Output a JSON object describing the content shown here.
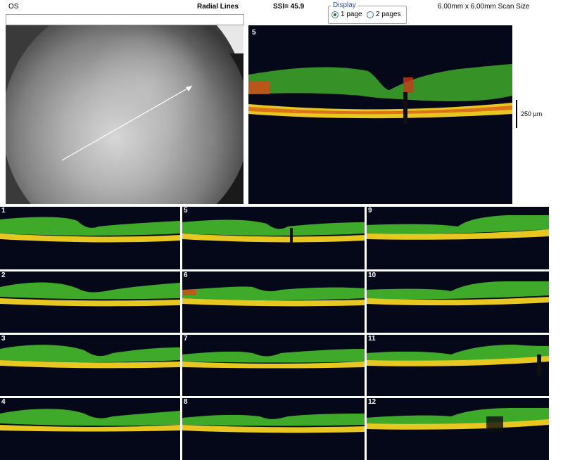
{
  "header": {
    "eye": "OS",
    "scan_name": "Radial Lines",
    "ssi": "SSI= 45.9",
    "scan_size": "6.00mm x 6.00mm Scan Size"
  },
  "display": {
    "legend": "Display",
    "options": [
      "1 page",
      "2 pages"
    ],
    "selected": "1 page"
  },
  "main_scan": {
    "number": "5",
    "scale_label": "250 µm"
  },
  "thumbnails": [
    {
      "number": "1"
    },
    {
      "number": "5"
    },
    {
      "number": "9"
    },
    {
      "number": "2"
    },
    {
      "number": "6"
    },
    {
      "number": "10"
    },
    {
      "number": "3"
    },
    {
      "number": "7"
    },
    {
      "number": "11"
    },
    {
      "number": "4"
    },
    {
      "number": "8"
    },
    {
      "number": "12"
    }
  ],
  "colors": {
    "background": "#050818",
    "layer_green": "#3fae2a",
    "layer_yellow": "#e8d020",
    "layer_red": "#d83018"
  }
}
